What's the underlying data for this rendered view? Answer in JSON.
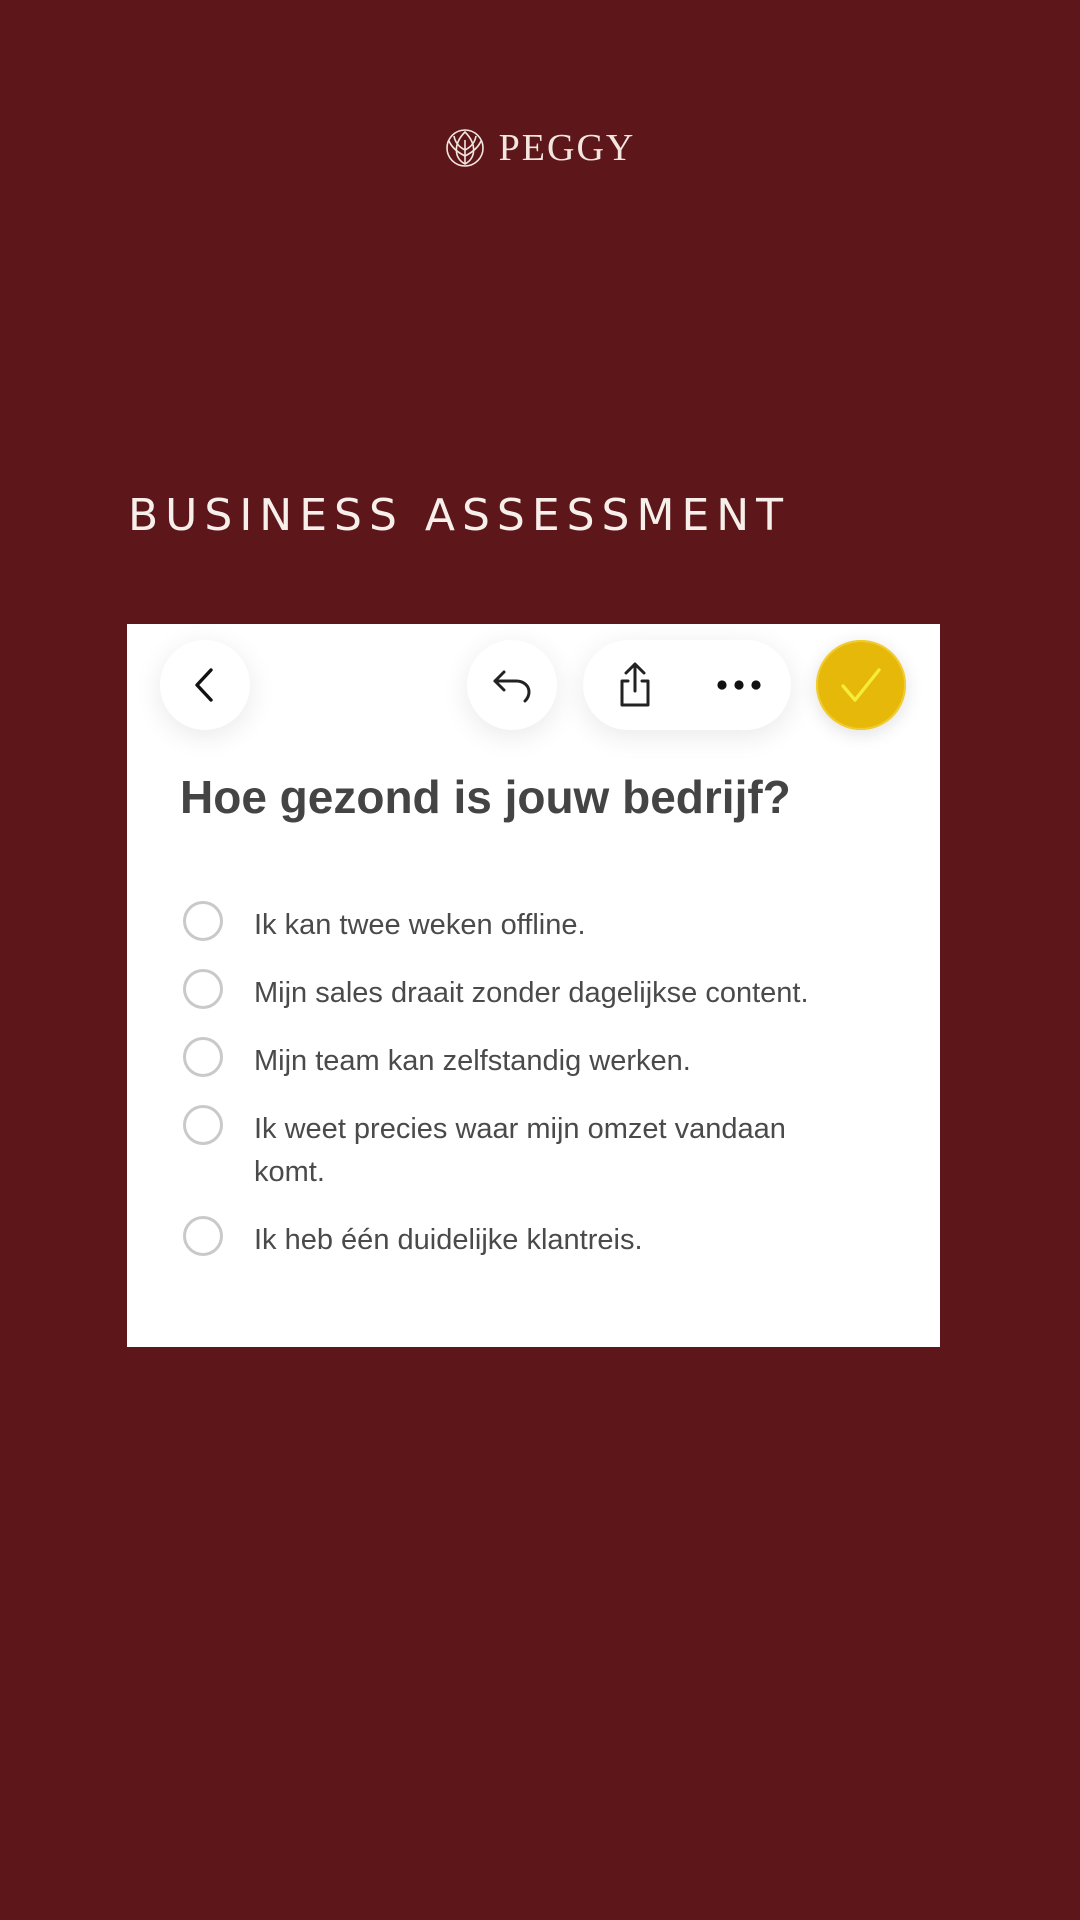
{
  "brand": {
    "name": "PEGGY",
    "text_color": "#f3e6df"
  },
  "page": {
    "background": "#5d171b",
    "headline": "BUSINESS ASSESSMENT"
  },
  "toolbar": {
    "back_icon": "chevron-left-icon",
    "undo_icon": "undo-arrow-icon",
    "share_icon": "share-icon",
    "more_icon": "ellipsis-icon",
    "done_icon": "checkmark-icon",
    "done_color": "#e6b80a"
  },
  "card": {
    "question": "Hoe gezond is jouw bedrijf?",
    "options": [
      {
        "label": "Ik kan twee weken offline.",
        "checked": false
      },
      {
        "label": "Mijn sales draait zonder dagelijkse content.",
        "checked": false
      },
      {
        "label": "Mijn team kan zelfstandig werken.",
        "checked": false
      },
      {
        "label": "Ik weet precies waar mijn omzet vandaan komt.",
        "checked": false
      },
      {
        "label": "Ik heb één duidelijke klantreis.",
        "checked": false
      }
    ]
  }
}
